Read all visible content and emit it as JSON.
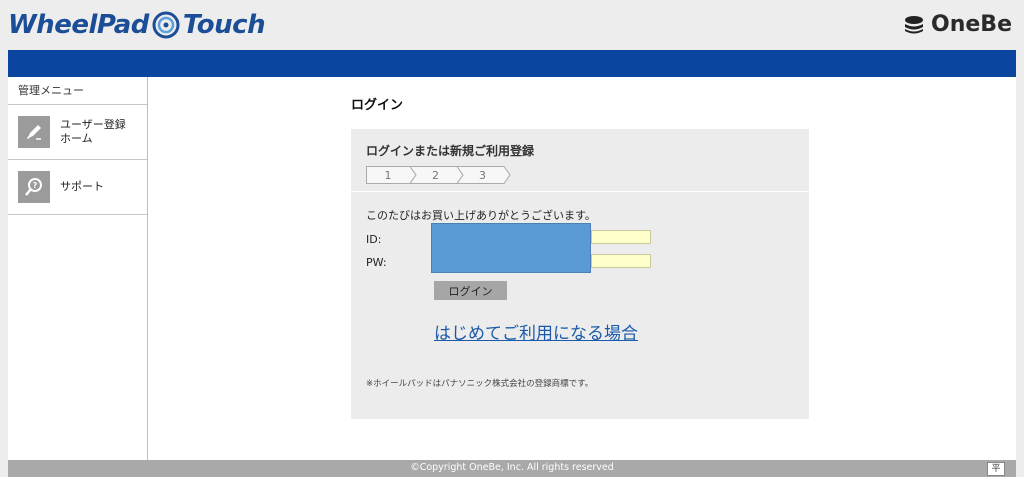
{
  "header": {
    "logo_part1": "WheelPad",
    "logo_part2": "Touch",
    "brand": "OneBe"
  },
  "sidebar": {
    "title": "管理メニュー",
    "items": [
      {
        "label": "ユーザー登録\nホーム",
        "icon": "pen-icon"
      },
      {
        "label": "サポート",
        "icon": "help-magnifier-icon"
      }
    ]
  },
  "main": {
    "page_title": "ログイン",
    "panel": {
      "subtitle": "ログインまたは新規ご利用登録",
      "steps": [
        "1",
        "2",
        "3"
      ],
      "thanks": "このたびはお買い上げありがとうございます。",
      "id_label": "ID:",
      "pw_label": "PW:",
      "id_value": "",
      "pw_value": "",
      "login_button": "ログイン",
      "first_time_link": "はじめてご利用になる場合",
      "trademark_note": "※ホイールパッドはパナソニック株式会社の登録商標です。"
    }
  },
  "footer": {
    "copyright": "©Copyright OneBe, Inc. All rights reserved",
    "top_button": "平"
  },
  "colors": {
    "accent_bar": "#0a46a0",
    "logo_blue": "#1b4e96",
    "input_bg": "#ffffcc",
    "link": "#1a5aa8"
  }
}
